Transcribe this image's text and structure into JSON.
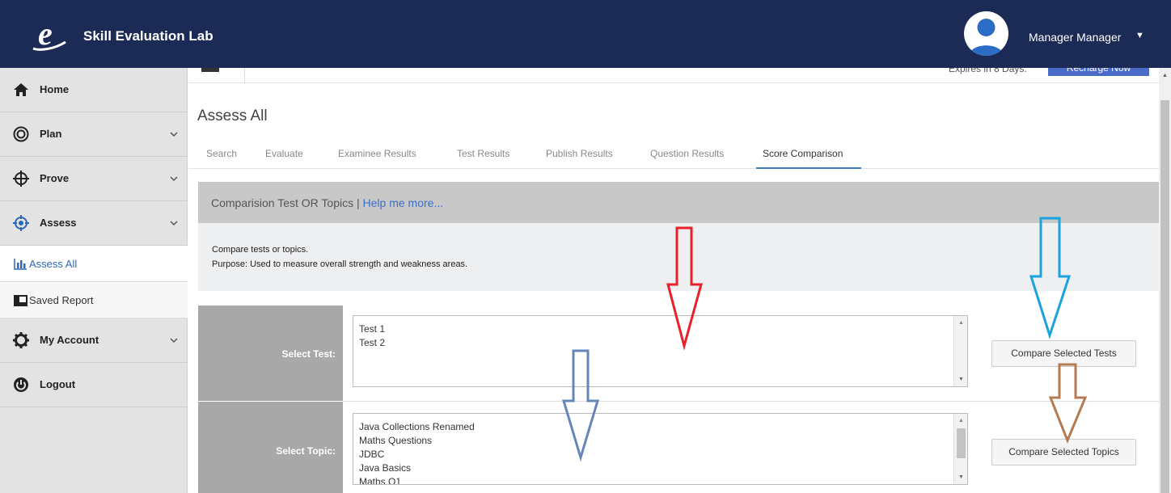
{
  "app": {
    "title": "Skill Evaluation Lab"
  },
  "user": {
    "name": "Manager Manager",
    "caret": "▼"
  },
  "sidebar": {
    "items": [
      {
        "label": "Home",
        "icon": "home-icon"
      },
      {
        "label": "Plan",
        "icon": "target-icon"
      },
      {
        "label": "Prove",
        "icon": "crosshair-icon"
      },
      {
        "label": "Assess",
        "icon": "assess-icon"
      },
      {
        "label": "My Account",
        "icon": "gear-icon"
      },
      {
        "label": "Logout",
        "icon": "power-icon"
      }
    ],
    "subitems": [
      {
        "label": "Assess All",
        "icon": "bar-chart-icon"
      },
      {
        "label": "Saved Report",
        "icon": "report-icon"
      }
    ]
  },
  "header": {
    "expires_text": "Expires in 8 Days.",
    "recharge_label": "Recharge Now"
  },
  "page": {
    "title": "Assess All",
    "tabs": [
      "Search",
      "Evaluate",
      "Examinee Results",
      "Test Results",
      "Publish Results",
      "Question Results",
      "Score Comparison"
    ],
    "active_tab": "Score Comparison"
  },
  "panel": {
    "heading": "Comparision Test OR Topics | ",
    "help_link": "Help me more...",
    "desc_line1": "Compare tests or topics.",
    "desc_line2": "Purpose: Used to measure overall strength and weakness areas."
  },
  "form": {
    "test_label": "Select Test:",
    "test_options": [
      "Test 1",
      "Test 2"
    ],
    "test_button": "Compare Selected Tests",
    "topic_label": "Select Topic:",
    "topic_options": [
      "Java Collections Renamed",
      "Maths Questions",
      "JDBC",
      "Java Basics",
      "Maths Q1"
    ],
    "topic_button": "Compare Selected Topics"
  },
  "annotations": {
    "arrow_colors": [
      "#e8202a",
      "#1aa3dd",
      "#6785b8",
      "#b57a4f"
    ]
  }
}
